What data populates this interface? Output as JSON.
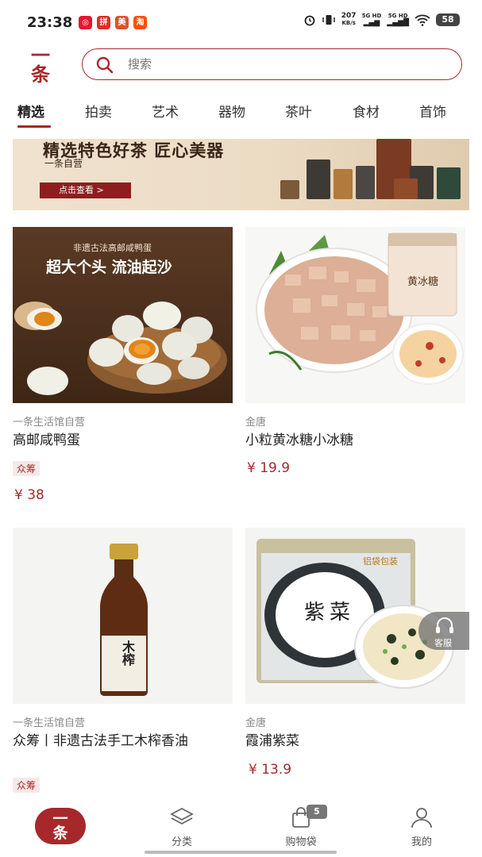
{
  "status_bar": {
    "time": "23:38",
    "app_icons": [
      "weibo",
      "pinduoduo",
      "meituan",
      "taobao"
    ],
    "network_speed": "207",
    "speed_unit": "KB/s",
    "sim1": "5G HD",
    "sim2": "5G HD",
    "battery": "58"
  },
  "header": {
    "logo": "一\n条",
    "search_placeholder": "搜索"
  },
  "tabs": [
    "精选",
    "拍卖",
    "艺术",
    "器物",
    "茶叶",
    "食材",
    "首饰"
  ],
  "active_tab": 0,
  "banner": {
    "title": "精选特色好茶 匠心美器",
    "subtitle": "一条自营",
    "button": "点击查看 >"
  },
  "products": [
    {
      "brand": "一条生活馆自营",
      "name": "高邮咸鸭蛋",
      "tag": "众筹",
      "price": "¥ 38",
      "img_title": "非遗古法高邮咸鸭蛋",
      "img_slogan": "超大个头 流油起沙"
    },
    {
      "brand": "金唐",
      "name": "小粒黄冰糖小冰糖",
      "tag": "",
      "price": "¥ 19.9",
      "img_label": "黄冰糖"
    },
    {
      "brand": "一条生活馆自营",
      "name": "众筹丨非遗古法手工木榨香油",
      "tag": "众筹",
      "price": "",
      "img_label": "木榨"
    },
    {
      "brand": "金唐",
      "name": "霞浦紫菜",
      "tag": "",
      "price": "¥ 13.9",
      "img_label": "紫菜",
      "img_badge": "铝袋包装"
    }
  ],
  "floating": {
    "service_label": "客服"
  },
  "bottom_nav": {
    "home": "一\n条",
    "items": [
      {
        "label": "分类",
        "icon": "layers-icon"
      },
      {
        "label": "购物袋",
        "icon": "bag-icon",
        "badge": "5"
      },
      {
        "label": "我的",
        "icon": "person-icon"
      }
    ]
  },
  "colors": {
    "accent": "#a7282b"
  }
}
